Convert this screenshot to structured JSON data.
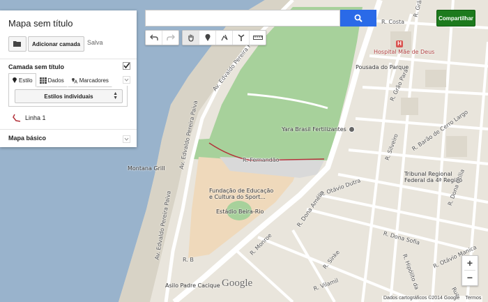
{
  "panel": {
    "title": "Mapa sem título",
    "add_layer_label": "Adicionar camada",
    "saved_label": "Salva",
    "layer_name": "Camada sem título",
    "tabs": [
      {
        "label": "Estilo",
        "icon": "paint-icon"
      },
      {
        "label": "Dados",
        "icon": "table-icon"
      },
      {
        "label": "Marcadores",
        "icon": "label-icon"
      }
    ],
    "style_dropdown": "Estilos individuais",
    "line_item": "Linha 1",
    "base_map": "Mapa básico"
  },
  "search": {
    "placeholder": ""
  },
  "share_label": "Compartilhar",
  "colors": {
    "accent_blue": "#2a6ae8",
    "share_green": "#1d7a1d",
    "water": "#99b3cc",
    "park": "#a7d19b",
    "line": "#b3323a"
  },
  "map_labels": {
    "hospital": "Hospital Mãe de Deus",
    "pousada": "Pousada do Parque",
    "yara": "Yara Brasil Fertilizantes",
    "montana": "Montana Grill",
    "fundacao1": "Fundação de Educação",
    "fundacao2": "e Cultura do Sport...",
    "estadio": "Estádio Beira-Rio",
    "tribunal1": "Tribunal Regional",
    "tribunal2": "Federal da 4ª Região",
    "asilo": "Asilo Padre Cacique",
    "costa": "R. Costa",
    "grao_para": "R. Grão Pará",
    "grao_para2": "R. Grão Pará",
    "edvaldo1": "Av. Edvaldo Pereira Paiva",
    "edvaldo2": "Av. Edvaldo Pereira Paiva",
    "edvaldo3": "Av. Edvaldo Pereira Paiva",
    "fernandao": "R. Fernandão",
    "silveiro": "R. Silveiro",
    "barao": "R. Barão de Cerro Largo",
    "otavio": "R. Otávio Dutra",
    "amelia": "R. Dona Amélia",
    "sofia": "R. Dona Sofia",
    "oxosina": "R. Dona Otília",
    "monroe": "R. Monroe",
    "sinke": "R. Sinke",
    "vilamil": "R. Vilamil",
    "rb": "R. B",
    "hipolito": "R. Hipólito da",
    "otavio_m": "R. Otávio Manica",
    "rua": "Rua"
  },
  "google_logo": "Google",
  "footer": {
    "data": "Dados cartográficos ©2014 Google",
    "terms": "Termos"
  },
  "zoom": {
    "in": "+",
    "out": "−"
  }
}
